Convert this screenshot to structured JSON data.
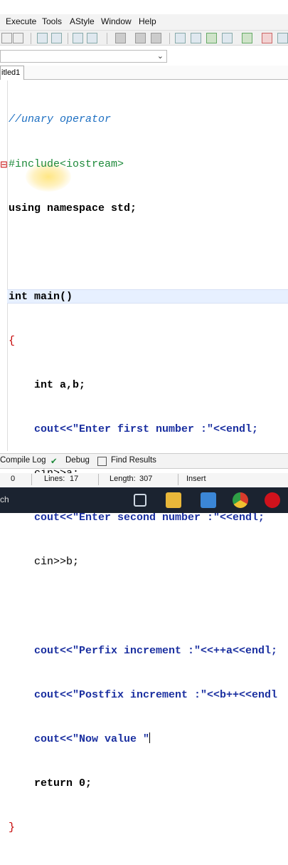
{
  "menu": {
    "items": [
      "Execute",
      "Tools",
      "AStyle",
      "Window",
      "Help"
    ]
  },
  "file_tab": {
    "label": "itled1"
  },
  "code_lines": [
    "//unary operator",
    "#include<iostream>",
    "using namespace std;",
    "",
    "int main()",
    "{",
    "    int a,b;",
    "    cout<<\"Enter first number :\"<<endl;",
    "    cin>>a;",
    "    cout<<\"Enter second number :\"<<endl;",
    "    cin>>b;",
    "",
    "    cout<<\"Perfix increment :\"<<++a<<endl;",
    "    cout<<\"Postfix increment :\"<<b++<<endl",
    "    cout<<\"Now value \"",
    "    return 0;",
    "}"
  ],
  "bottom_tabs": {
    "compile_log": "Compile Log",
    "debug": "Debug",
    "find_results": "Find Results"
  },
  "status": {
    "col": "0",
    "lines_label": "Lines:",
    "lines_value": "17",
    "length_label": "Length:",
    "length_value": "307",
    "mode": "Insert"
  },
  "taskbar": {
    "search_text": "ch"
  },
  "colors": {
    "comment": "#1d6fc2",
    "preprocessor": "#1d8a3a",
    "string": "#1a2fa0",
    "active_line": "#e7f0ff",
    "taskbar": "#1b2330"
  }
}
